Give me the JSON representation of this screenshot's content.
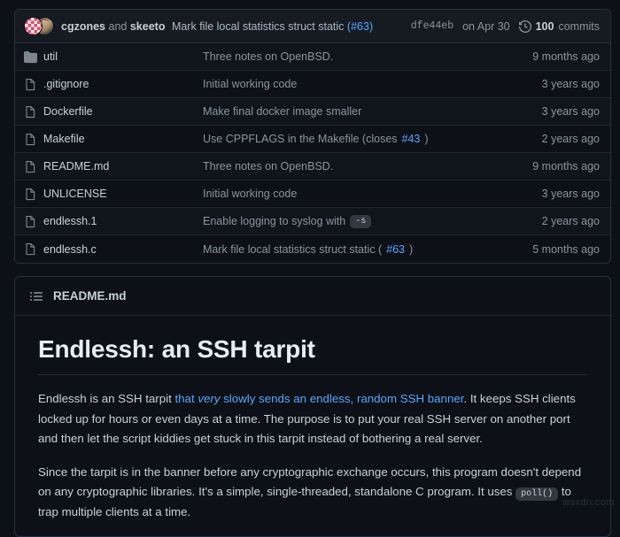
{
  "commit_header": {
    "author_primary": "cgzones",
    "conjunction": "and",
    "author_secondary": "skeeto",
    "message": "Mark file local statistics struct static",
    "issue_ref": "(#63)",
    "hash": "dfe44eb",
    "date": "on Apr 30",
    "commits_count": "100",
    "commits_label": "commits",
    "history_icon": "history-icon",
    "avatar_primary": "avatar-cgzones",
    "avatar_secondary": "avatar-skeeto"
  },
  "files": [
    {
      "icon": "folder-icon",
      "type": "directory",
      "name": "util",
      "message": "Three notes on OpenBSD.",
      "code_badge": "",
      "issue_ref": "",
      "time": "9 months ago"
    },
    {
      "icon": "file-icon",
      "type": "file",
      "name": ".gitignore",
      "message": "Initial working code",
      "code_badge": "",
      "issue_ref": "",
      "time": "3 years ago"
    },
    {
      "icon": "file-icon",
      "type": "file",
      "name": "Dockerfile",
      "message": "Make final docker image smaller",
      "code_badge": "",
      "issue_ref": "",
      "time": "3 years ago"
    },
    {
      "icon": "file-icon",
      "type": "file",
      "name": "Makefile",
      "message": "Use CPPFLAGS in the Makefile (closes ",
      "code_badge": "",
      "issue_ref": "#43",
      "message_tail": ")",
      "time": "2 years ago"
    },
    {
      "icon": "file-icon",
      "type": "file",
      "name": "README.md",
      "message": "Three notes on OpenBSD.",
      "code_badge": "",
      "issue_ref": "",
      "time": "9 months ago"
    },
    {
      "icon": "file-icon",
      "type": "file",
      "name": "UNLICENSE",
      "message": "Initial working code",
      "code_badge": "",
      "issue_ref": "",
      "time": "3 years ago"
    },
    {
      "icon": "file-icon",
      "type": "file",
      "name": "endlessh.1",
      "message": "Enable logging to syslog with",
      "code_badge": "-s",
      "issue_ref": "",
      "time": "2 years ago"
    },
    {
      "icon": "file-icon",
      "type": "file",
      "name": "endlessh.c",
      "message": "Mark file local statistics struct static (",
      "code_badge": "",
      "issue_ref": "#63",
      "message_tail": ")",
      "time": "5 months ago"
    }
  ],
  "readme": {
    "icon": "list-unordered-icon",
    "title": "README.md",
    "heading": "Endlessh: an SSH tarpit",
    "paragraph1": {
      "lead": "Endlessh is an SSH tarpit ",
      "link_pre": "that ",
      "link_em": "very",
      "link_post": " slowly sends an endless, random SSH banner",
      "tail": ". It keeps SSH clients locked up for hours or even days at a time. The purpose is to put your real SSH server on another port and then let the script kiddies get stuck in this tarpit instead of bothering a real server."
    },
    "paragraph2": {
      "lead": "Since the tarpit is in the banner before any cryptographic exchange occurs, this program doesn't depend on any cryptographic libraries. It's a simple, single-threaded, standalone C program. It uses ",
      "code": "poll()",
      "tail": " to trap multiple clients at a time."
    }
  },
  "watermark": "wsxdn.com",
  "colors": {
    "page_bg": "#0d1117",
    "panel_header_bg": "#161b22",
    "border": "#27303d",
    "link": "#58a6ff",
    "text": "#c9d1d9",
    "muted": "#8b949e"
  }
}
